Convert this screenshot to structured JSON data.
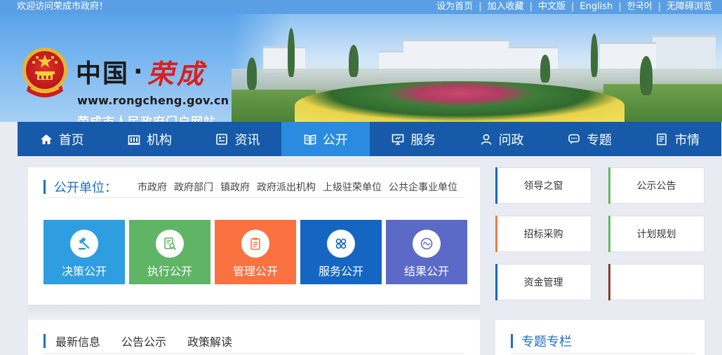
{
  "topbar": {
    "welcome": "欢迎访问荣成市政府！",
    "links": [
      "设为首页",
      "加入收藏",
      "中文版",
      "English",
      "한국어",
      "无障碍浏览"
    ]
  },
  "header": {
    "title_cn": "中国",
    "title_dot": "·",
    "title_city": "荣成",
    "url": "www.rongcheng.gov.cn",
    "subtitle": "荣成市人民政府门户网站"
  },
  "nav": {
    "items": [
      {
        "label": "首页",
        "icon": "home-icon"
      },
      {
        "label": "机构",
        "icon": "building-icon"
      },
      {
        "label": "资讯",
        "icon": "news-icon"
      },
      {
        "label": "公开",
        "icon": "book-icon",
        "active": true
      },
      {
        "label": "服务",
        "icon": "monitor-icon"
      },
      {
        "label": "问政",
        "icon": "user-icon"
      },
      {
        "label": "专题",
        "icon": "chat-icon"
      },
      {
        "label": "市情",
        "icon": "document-icon"
      }
    ]
  },
  "units": {
    "title": "公开单位：",
    "links": [
      "市政府",
      "政府部门",
      "镇政府",
      "政府派出机构",
      "上级驻荣单位",
      "公共企事业单位"
    ]
  },
  "tiles": [
    {
      "label": "决策公开",
      "color": "#2e9ee0",
      "icon": "gavel-icon"
    },
    {
      "label": "执行公开",
      "color": "#5fb565",
      "icon": "search-doc-icon"
    },
    {
      "label": "管理公开",
      "color": "#fb7140",
      "icon": "clipboard-icon"
    },
    {
      "label": "服务公开",
      "color": "#1466c2",
      "icon": "grid-icon"
    },
    {
      "label": "结果公开",
      "color": "#5a6ac6",
      "icon": "wave-icon"
    }
  ],
  "news": {
    "tabs": [
      "最新信息",
      "公告公示",
      "政策解读"
    ]
  },
  "cards": [
    {
      "label": "领导之窗",
      "accent": "#1b63c0"
    },
    {
      "label": "公示公告",
      "accent": "#5dbb5b"
    },
    {
      "label": "招标采购",
      "accent": "#f07a4a"
    },
    {
      "label": "计划规划",
      "accent": "#5dbb5b"
    },
    {
      "label": "资金管理",
      "accent": "#1b63c0"
    },
    {
      "label": "",
      "accent": "#8a3b2a"
    }
  ],
  "special": {
    "title": "专题专栏"
  }
}
